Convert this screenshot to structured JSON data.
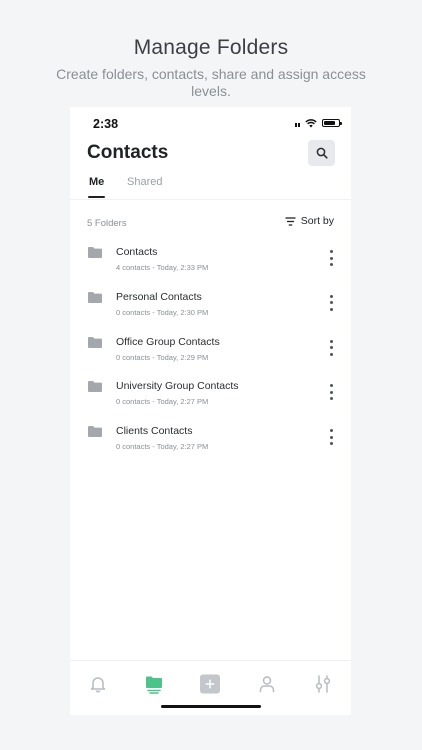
{
  "hero": {
    "title": "Manage Folders",
    "subtitle": "Create folders, contacts, share and assign access levels."
  },
  "status": {
    "time": "2:38"
  },
  "header": {
    "title": "Contacts"
  },
  "tabs": [
    {
      "label": "Me",
      "active": true
    },
    {
      "label": "Shared",
      "active": false
    }
  ],
  "list": {
    "count_label": "5 Folders",
    "sort_label": "Sort by",
    "folders": [
      {
        "name": "Contacts",
        "meta": "4 contacts - Today, 2:33 PM"
      },
      {
        "name": "Personal Contacts",
        "meta": "0 contacts - Today, 2:30 PM"
      },
      {
        "name": "Office Group Contacts",
        "meta": "0 contacts - Today, 2:29 PM"
      },
      {
        "name": "University Group Contacts",
        "meta": "0 contacts - Today, 2:27 PM"
      },
      {
        "name": "Clients Contacts",
        "meta": "0 contacts - Today, 2:27 PM"
      }
    ]
  },
  "tabbar": {
    "items": [
      {
        "icon": "bell-icon",
        "active": false
      },
      {
        "icon": "folder-icon",
        "active": true
      },
      {
        "icon": "add-icon",
        "active": false
      },
      {
        "icon": "user-icon",
        "active": false
      },
      {
        "icon": "settings-sliders-icon",
        "active": false
      }
    ]
  },
  "colors": {
    "accent": "#4cc389",
    "inactive_icon": "#b7bbc0",
    "folder_icon": "#a4a8ad"
  }
}
